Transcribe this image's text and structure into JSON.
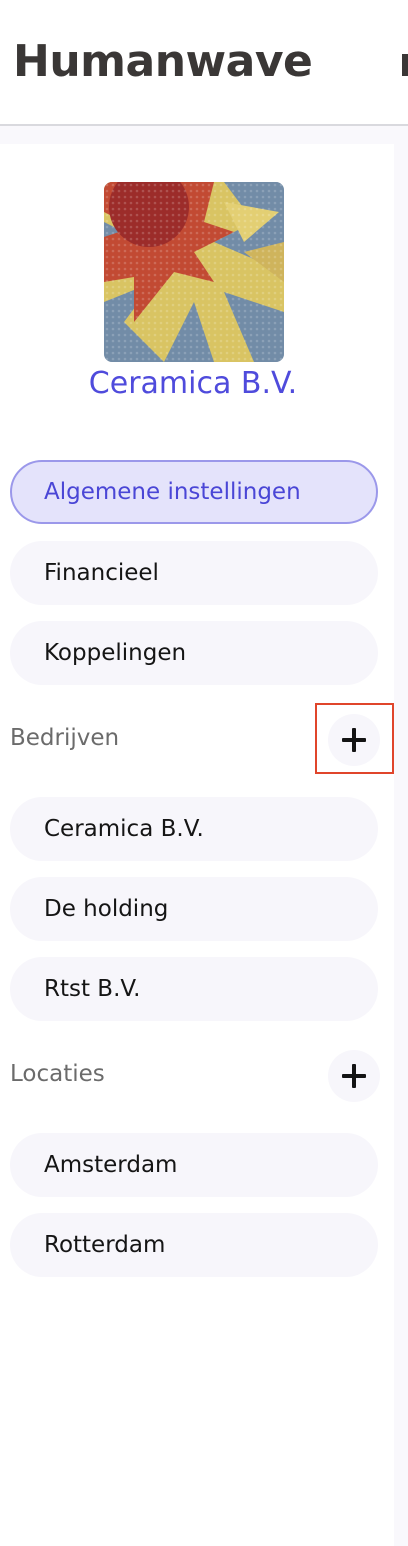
{
  "app": {
    "brand": "Humanwave"
  },
  "organization": {
    "name": "Ceramica B.V.",
    "logo_icon": "sun-mosaic-logo"
  },
  "settings_nav": [
    {
      "label": "Algemene instellingen",
      "active": true
    },
    {
      "label": "Financieel",
      "active": false
    },
    {
      "label": "Koppelingen",
      "active": false
    }
  ],
  "companies": {
    "label": "Bedrijven",
    "add_icon": "plus-icon",
    "items": [
      "Ceramica B.V.",
      "De holding",
      "Rtst B.V."
    ]
  },
  "locations": {
    "label": "Locaties",
    "add_icon": "plus-icon",
    "items": [
      "Amsterdam",
      "Rotterdam"
    ]
  },
  "colors": {
    "accent": "#4f4bdc",
    "active_bg": "#e4e3fb",
    "highlight": "#e0452b"
  }
}
